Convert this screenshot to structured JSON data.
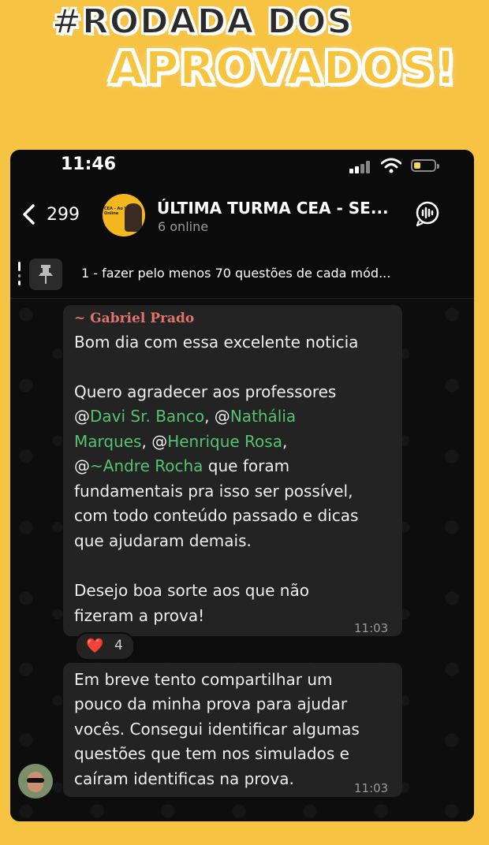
{
  "headline": {
    "line1": "#RODADA DOS",
    "line2": "APROVADOS!"
  },
  "status_bar": {
    "time": "11:46"
  },
  "chat_header": {
    "back_count": "299",
    "group_name": "ÚLTIMA TURMA CEA - SE...",
    "online": "6 online"
  },
  "pinned": {
    "text": "1 - fazer pelo menos 70 questões de cada mód..."
  },
  "messages": [
    {
      "sender": "~ Gabriel Prado",
      "text": {
        "greeting": "Bom dia com essa excelente noticia",
        "thanks_line1": "Quero agradecer aos professores",
        "at1": "@",
        "m1": "Davi Sr. Banco",
        "sep1": ", @",
        "m2a": "Nathália",
        "m2b": "Marques",
        "sep2": ", @",
        "m3": "Henrique Rosa",
        "sep3": ",",
        "at4": "@",
        "m4": "~Andre Rocha",
        "after4": " que foram",
        "line5": "fundamentais pra isso ser possível,",
        "line6": "com todo conteúdo passado e dicas",
        "line7": "que ajudaram demais.",
        "closing1": "Desejo boa sorte aos que não",
        "closing2": "fizeram a prova!"
      },
      "time": "11:03",
      "reaction": {
        "emoji": "❤️",
        "count": "4"
      }
    },
    {
      "lines": [
        "Em breve tento compartilhar um",
        "pouco da minha prova para ajudar",
        "vocês. Consegui identificar algumas",
        "questões que tem nos simulados e",
        "caíram identificas na prova."
      ],
      "time": "11:03"
    }
  ],
  "colors": {
    "background": "#f6c343",
    "bubble": "#232323",
    "mention": "#56c271",
    "sender": "#e0746b"
  },
  "icons": [
    "back-chevron-icon",
    "signal-icon",
    "wifi-icon",
    "battery-icon",
    "voice-call-icon",
    "pin-icon",
    "heart-icon"
  ]
}
